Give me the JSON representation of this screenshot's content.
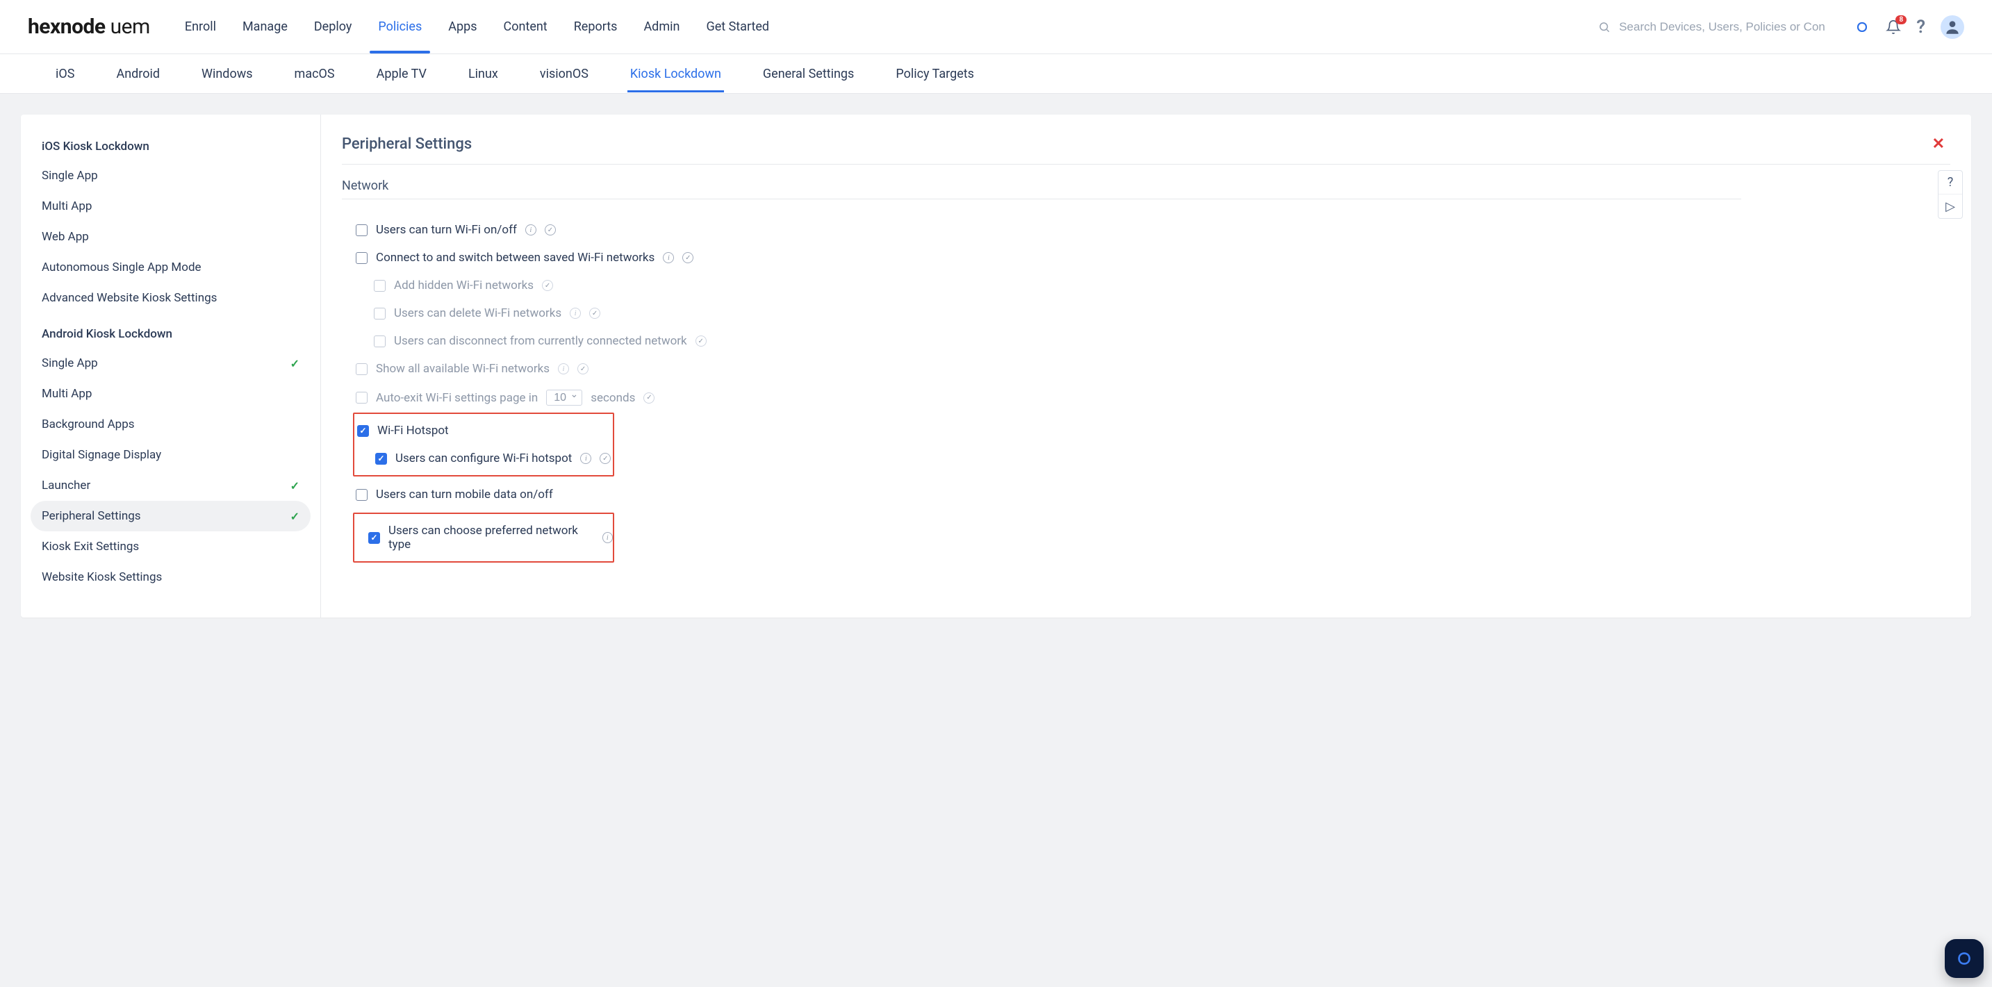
{
  "logo_brand": "hexnode",
  "logo_suffix": "uem",
  "main_nav": {
    "items": [
      "Enroll",
      "Manage",
      "Deploy",
      "Policies",
      "Apps",
      "Content",
      "Reports",
      "Admin",
      "Get Started"
    ],
    "active_index": 3
  },
  "search": {
    "placeholder": "Search Devices, Users, Policies or Content"
  },
  "notifications": {
    "count": "8"
  },
  "sub_tabs": {
    "items": [
      "iOS",
      "Android",
      "Windows",
      "macOS",
      "Apple TV",
      "Linux",
      "visionOS",
      "Kiosk Lockdown",
      "General Settings",
      "Policy Targets"
    ],
    "active_index": 7
  },
  "sidebar": {
    "groups": [
      {
        "title": "iOS Kiosk Lockdown",
        "items": [
          {
            "label": "Single App",
            "checked": false
          },
          {
            "label": "Multi App",
            "checked": false
          },
          {
            "label": "Web App",
            "checked": false
          },
          {
            "label": "Autonomous Single App Mode",
            "checked": false
          },
          {
            "label": "Advanced Website Kiosk Settings",
            "checked": false
          }
        ]
      },
      {
        "title": "Android Kiosk Lockdown",
        "items": [
          {
            "label": "Single App",
            "checked": true
          },
          {
            "label": "Multi App",
            "checked": false
          },
          {
            "label": "Background Apps",
            "checked": false
          },
          {
            "label": "Digital Signage Display",
            "checked": false
          },
          {
            "label": "Launcher",
            "checked": true
          },
          {
            "label": "Peripheral Settings",
            "checked": true,
            "active": true
          },
          {
            "label": "Kiosk Exit Settings",
            "checked": false
          },
          {
            "label": "Website Kiosk Settings",
            "checked": false
          }
        ]
      }
    ]
  },
  "panel": {
    "title": "Peripheral Settings",
    "section": "Network",
    "auto_exit_prefix": "Auto-exit Wi-Fi settings page in",
    "auto_exit_seconds_value": "10",
    "auto_exit_suffix": "seconds",
    "settings": {
      "wifi_onoff": {
        "label": "Users can turn Wi-Fi on/off",
        "checked": false,
        "disabled": false,
        "info": true,
        "verify": true
      },
      "connect_saved": {
        "label": "Connect to and switch between saved Wi-Fi networks",
        "checked": false,
        "disabled": false,
        "info": true,
        "verify": true
      },
      "add_hidden": {
        "label": "Add hidden Wi-Fi networks",
        "checked": false,
        "disabled": true,
        "info": false,
        "verify": true
      },
      "delete_wifi": {
        "label": "Users can delete Wi-Fi networks",
        "checked": false,
        "disabled": true,
        "info": true,
        "verify": true
      },
      "disconnect": {
        "label": "Users can disconnect from currently connected network",
        "checked": false,
        "disabled": true,
        "info": false,
        "verify": true
      },
      "show_all": {
        "label": "Show all available Wi-Fi networks",
        "checked": false,
        "disabled": true,
        "info": true,
        "verify": true
      },
      "auto_exit": {
        "label": "Auto-exit Wi-Fi settings page in",
        "checked": false,
        "disabled": true,
        "info": false,
        "verify": true
      },
      "hotspot": {
        "label": "Wi-Fi Hotspot",
        "checked": true,
        "disabled": false,
        "info": false,
        "verify": false
      },
      "hotspot_config": {
        "label": "Users can configure Wi-Fi hotspot",
        "checked": true,
        "disabled": false,
        "info": true,
        "verify": true
      },
      "mobile_data": {
        "label": "Users can turn mobile data on/off",
        "checked": false,
        "disabled": false,
        "info": false,
        "verify": false
      },
      "pref_net": {
        "label": "Users can choose preferred network type",
        "checked": true,
        "disabled": false,
        "info": true,
        "verify": false
      }
    }
  }
}
